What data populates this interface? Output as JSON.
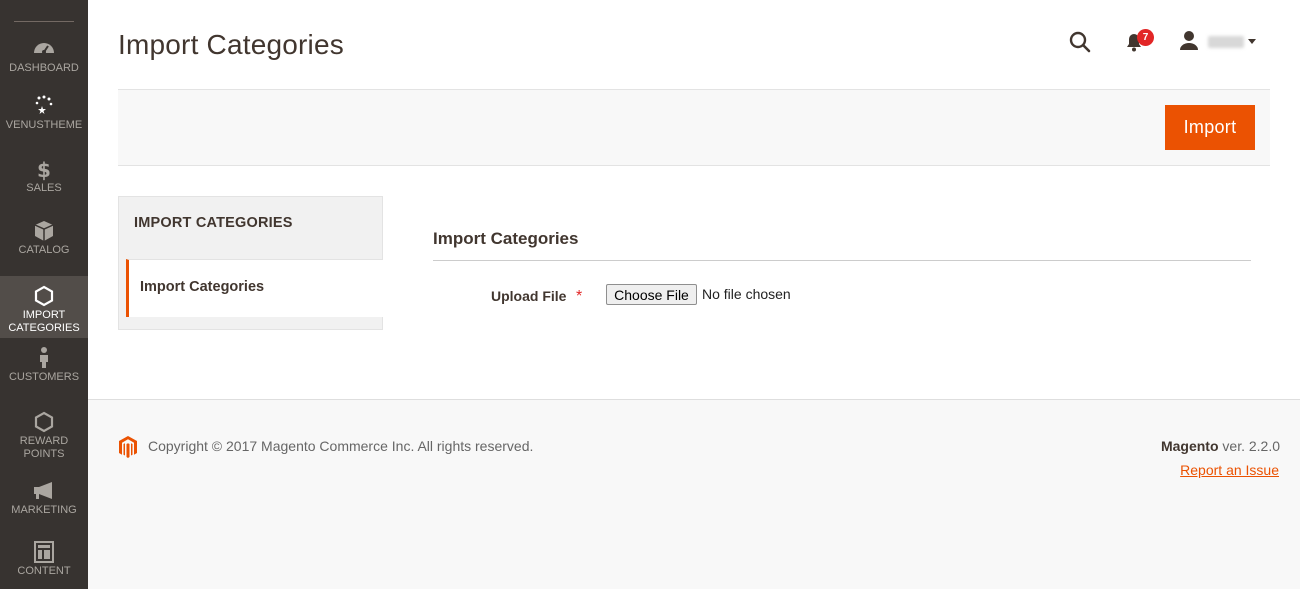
{
  "sidebar": {
    "items": [
      {
        "label": "DASHBOARD",
        "icon": "dashboard-icon"
      },
      {
        "label": "VENUSTHEME",
        "icon": "venustheme-icon"
      },
      {
        "label": "SALES",
        "icon": "dollar-icon"
      },
      {
        "label": "CATALOG",
        "icon": "box-icon"
      },
      {
        "label_line1": "IMPORT",
        "label_line2": "CATEGORIES",
        "icon": "hexagon-icon",
        "active": true
      },
      {
        "label": "CUSTOMERS",
        "icon": "person-icon"
      },
      {
        "label_line1": "REWARD",
        "label_line2": "POINTS",
        "icon": "hexagon-icon"
      },
      {
        "label": "MARKETING",
        "icon": "megaphone-icon"
      },
      {
        "label": "CONTENT",
        "icon": "layout-icon"
      }
    ]
  },
  "header": {
    "title": "Import Categories",
    "notifications_count": "7"
  },
  "actions": {
    "import_label": "Import"
  },
  "tabs": {
    "title": "IMPORT CATEGORIES",
    "items": [
      {
        "label": "Import Categories",
        "active": true
      }
    ]
  },
  "form": {
    "fieldset_title": "Import Categories",
    "upload_label": "Upload File",
    "required_marker": "*",
    "choose_file_label": "Choose File",
    "file_status": "No file chosen"
  },
  "footer": {
    "copyright": "Copyright © 2017 Magento Commerce Inc. All rights reserved.",
    "brand": "Magento",
    "version": " ver. 2.2.0",
    "report_link": "Report an Issue"
  },
  "colors": {
    "accent": "#eb5202",
    "sidebar_bg": "#373330",
    "sidebar_active_bg": "#524d49",
    "badge": "#e22626"
  }
}
